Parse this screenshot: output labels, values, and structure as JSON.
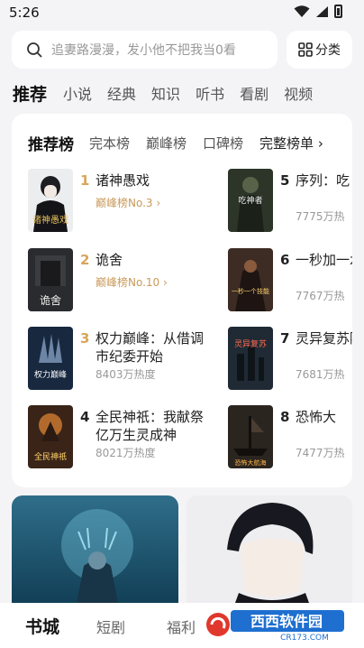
{
  "status": {
    "time": "5:26"
  },
  "search": {
    "placeholder": "追妻路漫漫，发小他不把我当0看",
    "category_label": "分类"
  },
  "top_tabs": [
    "推荐",
    "小说",
    "经典",
    "知识",
    "听书",
    "看剧",
    "视频"
  ],
  "rank_tabs": [
    "推荐榜",
    "完本榜",
    "巅峰榜",
    "口碑榜",
    "完整榜单 ›"
  ],
  "books": [
    {
      "rank": "1",
      "title": "诸神愚戏",
      "sub": "巅峰榜No.3 ›",
      "cover_text": "诸神愚戏"
    },
    {
      "rank": "2",
      "title": "诡舍",
      "sub": "巅峰榜No.10 ›",
      "cover_text": "诡舍"
    },
    {
      "rank": "3",
      "title": "权力巅峰：从借调市纪委开始",
      "sub": "8403万热度",
      "cover_text": "权力巅峰"
    },
    {
      "rank": "4",
      "title": "全民神祇：我献祭亿万生灵成神",
      "sub": "8021万热度",
      "cover_text": "全民神祇"
    },
    {
      "rank": "5",
      "title": "序列：吃",
      "sub": "7775万热",
      "cover_text": "吃神者"
    },
    {
      "rank": "6",
      "title": "一秒加一水，拿技",
      "sub": "7767万热",
      "cover_text": "一秒一个技能"
    },
    {
      "rank": "7",
      "title": "灵异复苏降临",
      "sub": "7681万热",
      "cover_text": "灵异复苏"
    },
    {
      "rank": "8",
      "title": "恐怖大",
      "sub": "7477万热",
      "cover_text": "恐怖大航海"
    }
  ],
  "bottom_nav": [
    "书城",
    "短剧",
    "福利"
  ],
  "watermark": {
    "text": "西西软件园",
    "url": "CR173.COM"
  },
  "colors": {
    "rank_gold": "#d9a55a",
    "page_bg": "#f4f4f6"
  }
}
